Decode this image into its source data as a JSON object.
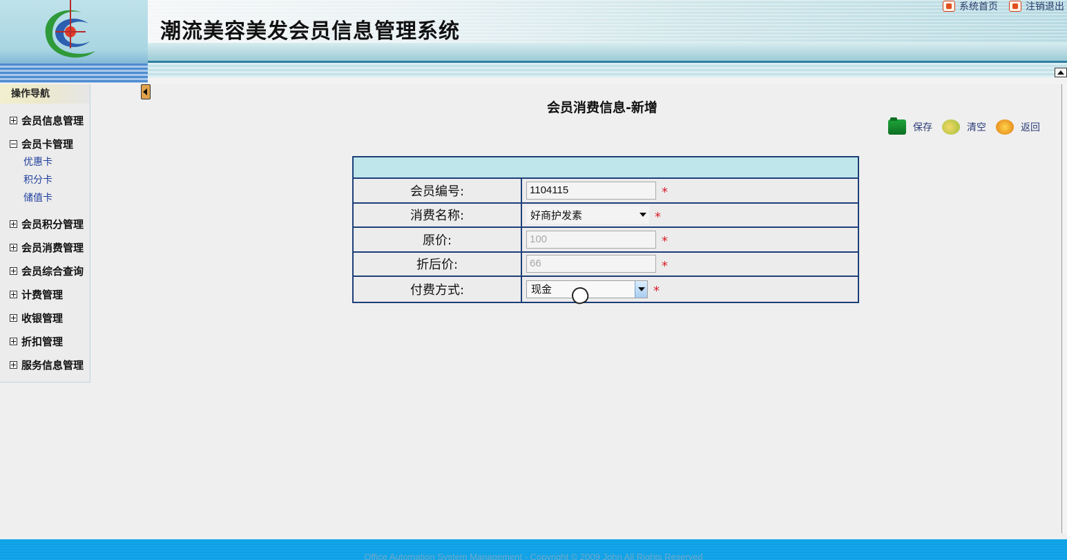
{
  "app": {
    "title": "潮流美容美发会员信息管理系统",
    "top_links": [
      "系统首页",
      "注销退出"
    ]
  },
  "sidebar": {
    "header": "操作导航",
    "groups": [
      {
        "label": "会员信息管理",
        "expanded": false
      },
      {
        "label": "会员卡管理",
        "expanded": true,
        "items": [
          "优惠卡",
          "积分卡",
          "储值卡"
        ]
      },
      {
        "label": "会员积分管理",
        "expanded": false
      },
      {
        "label": "会员消费管理",
        "expanded": false
      },
      {
        "label": "会员综合查询",
        "expanded": false
      },
      {
        "label": "计费管理",
        "expanded": false
      },
      {
        "label": "收银管理",
        "expanded": false
      },
      {
        "label": "折扣管理",
        "expanded": false
      },
      {
        "label": "服务信息管理",
        "expanded": false
      }
    ]
  },
  "main": {
    "title": "会员消费信息-新增",
    "toolbar": {
      "save": "保存",
      "clear": "清空",
      "back": "返回"
    },
    "form": {
      "rows": [
        {
          "label": "会员编号:",
          "value": "1104115",
          "type": "text"
        },
        {
          "label": "消费名称:",
          "value": "好商护发素",
          "type": "select"
        },
        {
          "label": "原价:",
          "value": "100",
          "type": "disabled"
        },
        {
          "label": "折后价:",
          "value": "66",
          "type": "disabled"
        },
        {
          "label": "付费方式:",
          "value": "现金",
          "type": "select"
        }
      ],
      "required_mark": "*"
    }
  },
  "footer": {
    "text": "Office Automation System Management - Copyright © 2009 John All Rights Reserved"
  },
  "colors": {
    "table_border": "#1c3e78",
    "table_header": "#bfe6ea",
    "required": "#d81e2a",
    "footer_bg": "#15a6ea"
  }
}
